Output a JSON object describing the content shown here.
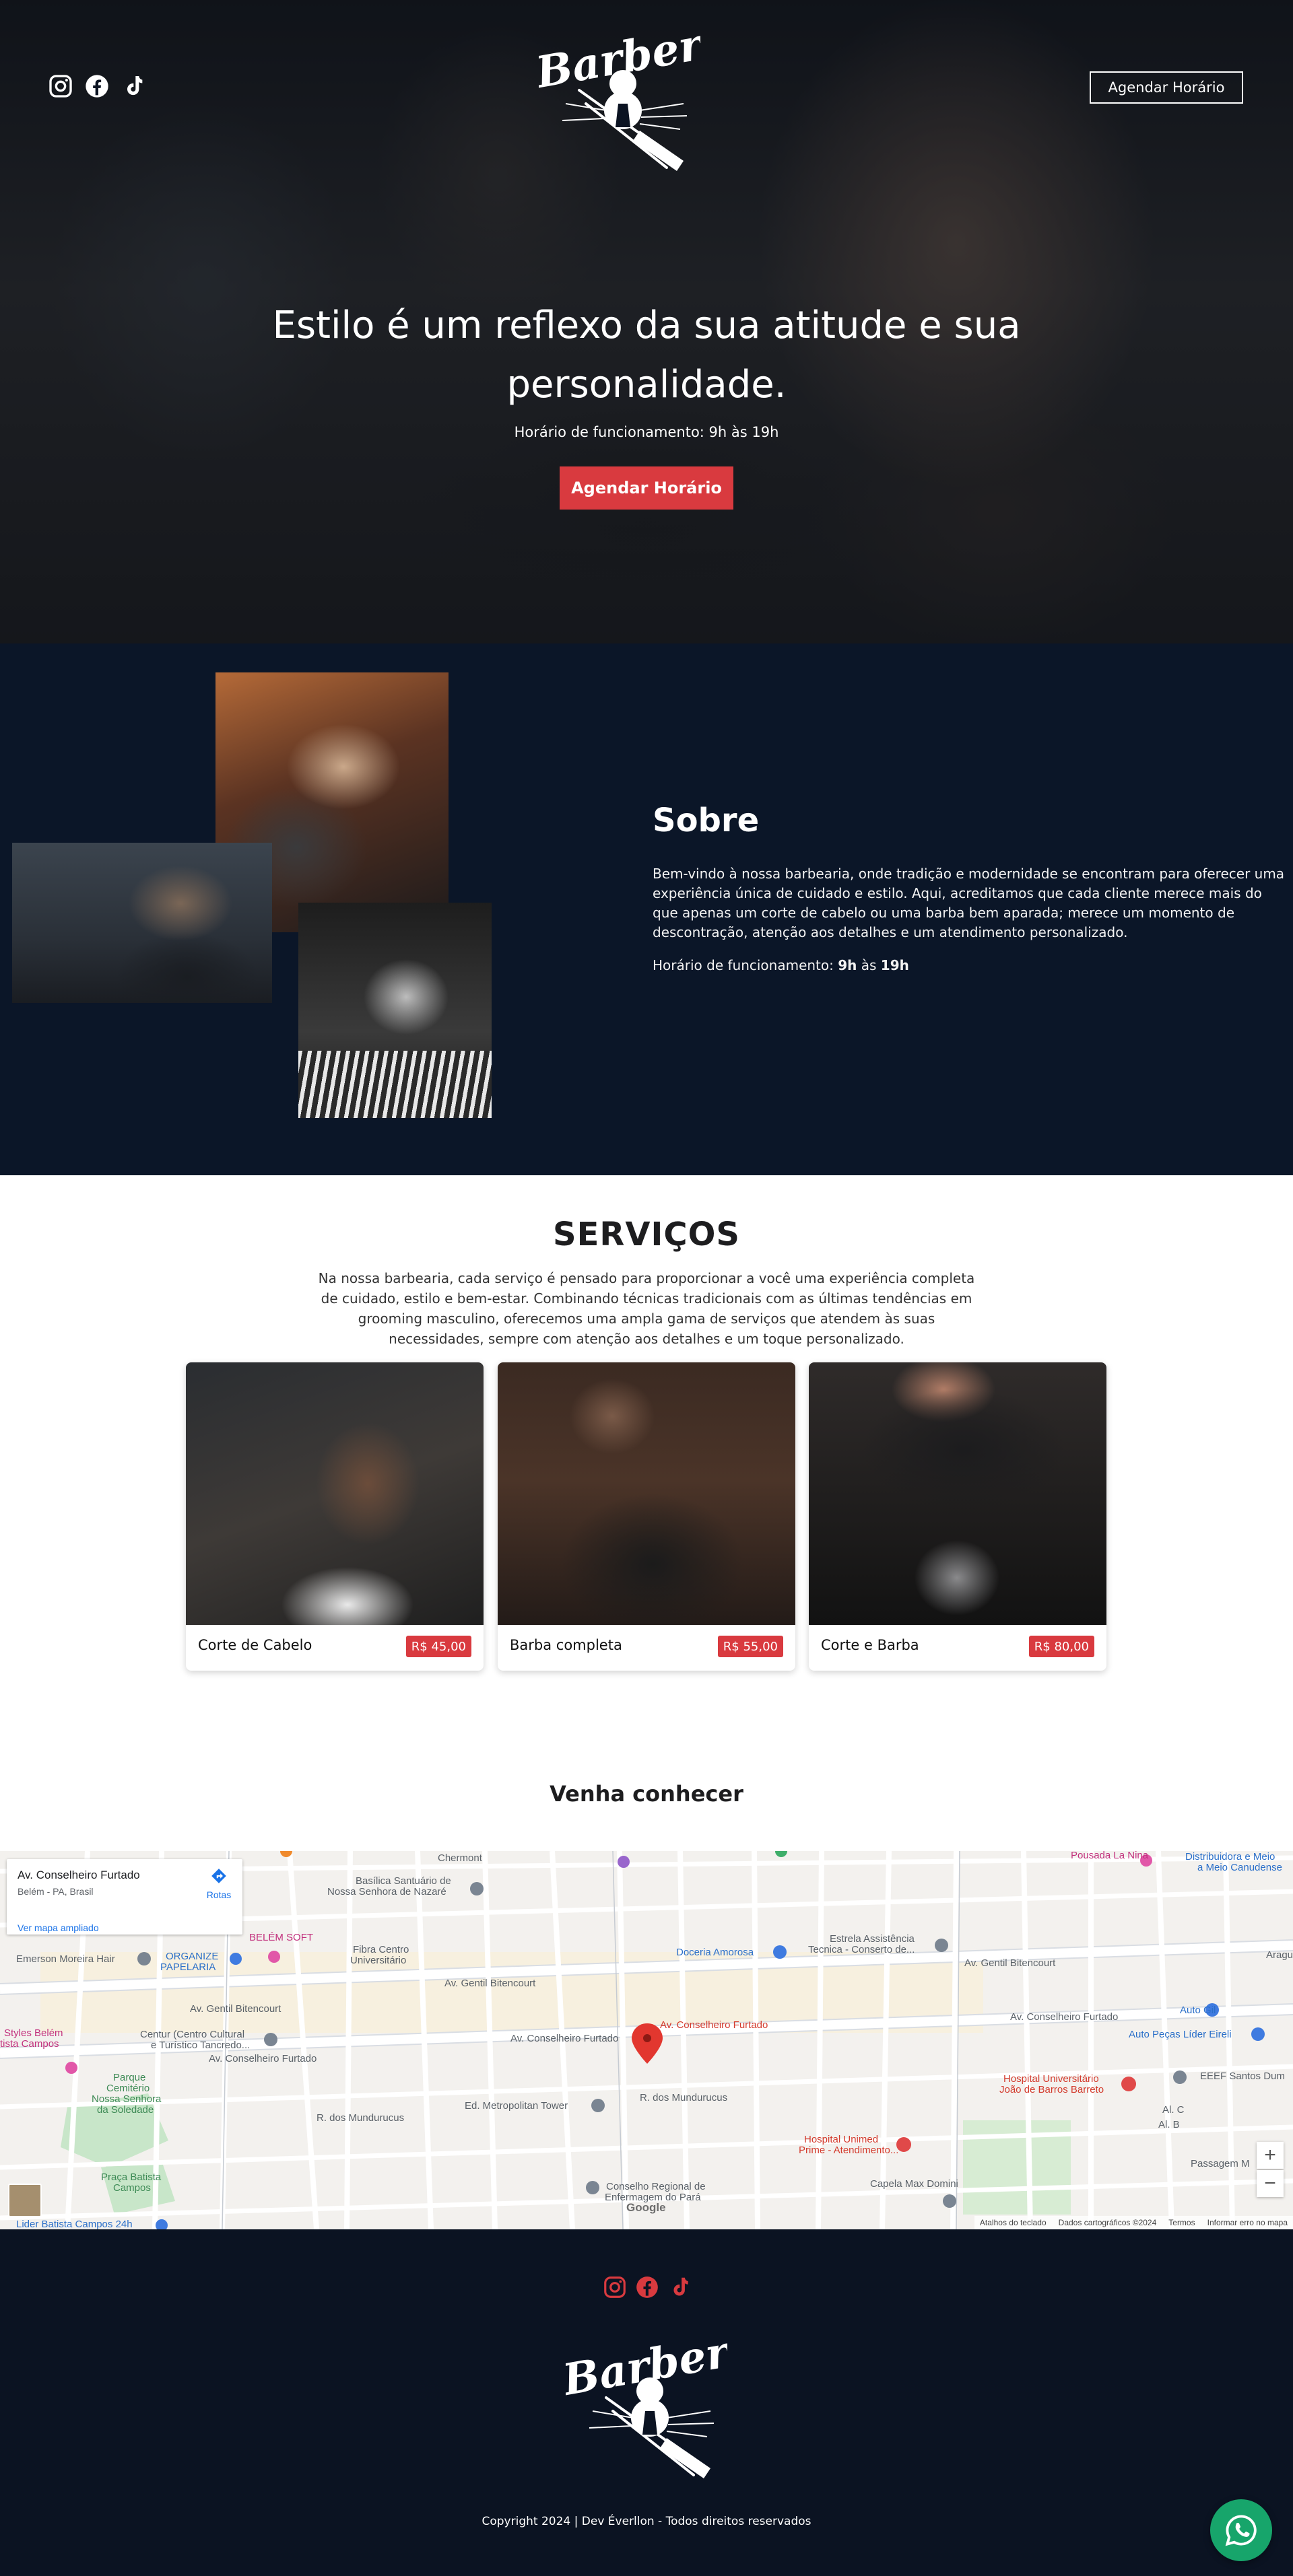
{
  "hero": {
    "cta_top": "Agendar Horário",
    "title": "Estilo é um reflexo da sua atitude e sua personalidade.",
    "hours": "Horário de funcionamento: 9h às 19h",
    "cta": "Agendar Horário",
    "social": [
      "instagram-icon",
      "facebook-icon",
      "tiktok-icon"
    ],
    "logo_text": "Barber"
  },
  "sobre": {
    "title": "Sobre",
    "text": "Bem-vindo à nossa barbearia, onde tradição e modernidade se encontram para oferecer uma experiência única de cuidado e estilo. Aqui, acreditamos que cada cliente merece mais do que apenas um corte de cabelo ou uma barba bem aparada; merece um momento de descontração, atenção aos detalhes e um atendimento personalizado.",
    "hours_label": "Horário de funcionamento: ",
    "hours_open": "9h",
    "hours_sep": " às ",
    "hours_close": "19h"
  },
  "servicos": {
    "title": "SERVIÇOS",
    "description": "Na nossa barbearia, cada serviço é pensado para proporcionar a você uma experiência completa de cuidado, estilo e bem-estar. Combinando técnicas tradicionais com as últimas tendências em grooming masculino, oferecemos uma ampla gama de serviços que atendem às suas necessidades, sempre com atenção aos detalhes e um toque personalizado.",
    "items": [
      {
        "name": "Corte de Cabelo",
        "price": "R$ 45,00"
      },
      {
        "name": "Barba completa",
        "price": "R$ 55,00"
      },
      {
        "name": "Corte e Barba",
        "price": "R$ 80,00"
      }
    ]
  },
  "venha": {
    "title": "Venha conhecer"
  },
  "map": {
    "card_title": "Av. Conselheiro Furtado",
    "card_sub": "Belém - PA, Brasil",
    "card_link": "Ver mapa ampliado",
    "directions": "Rotas",
    "marker_label": "Av. Conselheiro Furtado",
    "zoom_in": "+",
    "zoom_out": "−",
    "google": "Google",
    "footer": [
      "Atalhos do teclado",
      "Dados cartográficos ©2024",
      "Termos",
      "Informar erro no mapa"
    ],
    "labels": {
      "chermont": "Chermont",
      "basilica": "Basílica Santuário de",
      "basilica2": "Nossa Senhora de Nazaré",
      "pousada": "Pousada La Nina",
      "distribuidora": "Distribuidora e Meio",
      "distribuidora2": "a Meio Canudense",
      "emerson": "Emerson Moreira Hair",
      "belem_soft": "BELÉM SOFT",
      "organize": "ORGANIZE",
      "papelaria": "PAPELARIA",
      "fibra": "Fibra Centro",
      "fibra2": "Universitário",
      "doceria": "Doceria Amorosa",
      "estrela": "Estrela Assistência",
      "estrela2": "Tecnica - Conserto de...",
      "gentil_top": "Av. Gentil Bitencourt",
      "gentil_mid": "Av. Gentil Bitencourt",
      "gentil_left": "Av. Gentil Bitencourt",
      "auto_gil": "Auto Gil",
      "auto_pecas": "Auto Peças Líder Eireli",
      "styles": "Styles Belém",
      "styles2": "tista Campos",
      "centur": "Centur (Centro Cultural",
      "centur2": "e Turístico Tancredo...",
      "cons_left": "Av. Conselheiro Furtado",
      "cons_mid": "Av. Conselheiro Furtado",
      "cons_right": "Av. Conselheiro Furtado",
      "hosp_univ": "Hospital Universitário",
      "hosp_univ2": "João de Barros Barreto",
      "eeef": "EEEF Santos Dum",
      "parque": "Parque",
      "parque2": "Cemitério",
      "parque3": "Nossa Senhora",
      "parque4": "da Soledade",
      "metropolitan": "Ed. Metropolitan Tower",
      "mundurucus": "R. dos Mundurucus",
      "mundurucus_l": "R. dos Mundurucus",
      "unimed": "Hospital Unimed",
      "unimed2": "Prime - Atendimento...",
      "praca": "Praça Batista",
      "praca2": "Campos",
      "conselho": "Conselho Regional de",
      "conselho2": "Enfermagem do Pará",
      "capela": "Capela Max Domini",
      "lider": "Lider Batista Campos 24h",
      "passagem": "Passagem M",
      "al_c": "Al. C",
      "al_b": "Al. B",
      "aragu": "Aragu"
    }
  },
  "footer": {
    "logo_text": "Barber",
    "copyright": "Copyright 2024 | Dev Éverllon - Todos direitos reservados"
  },
  "colors": {
    "accent": "#d93a3f",
    "dark": "#0b1322",
    "whatsapp": "#17a56b"
  }
}
